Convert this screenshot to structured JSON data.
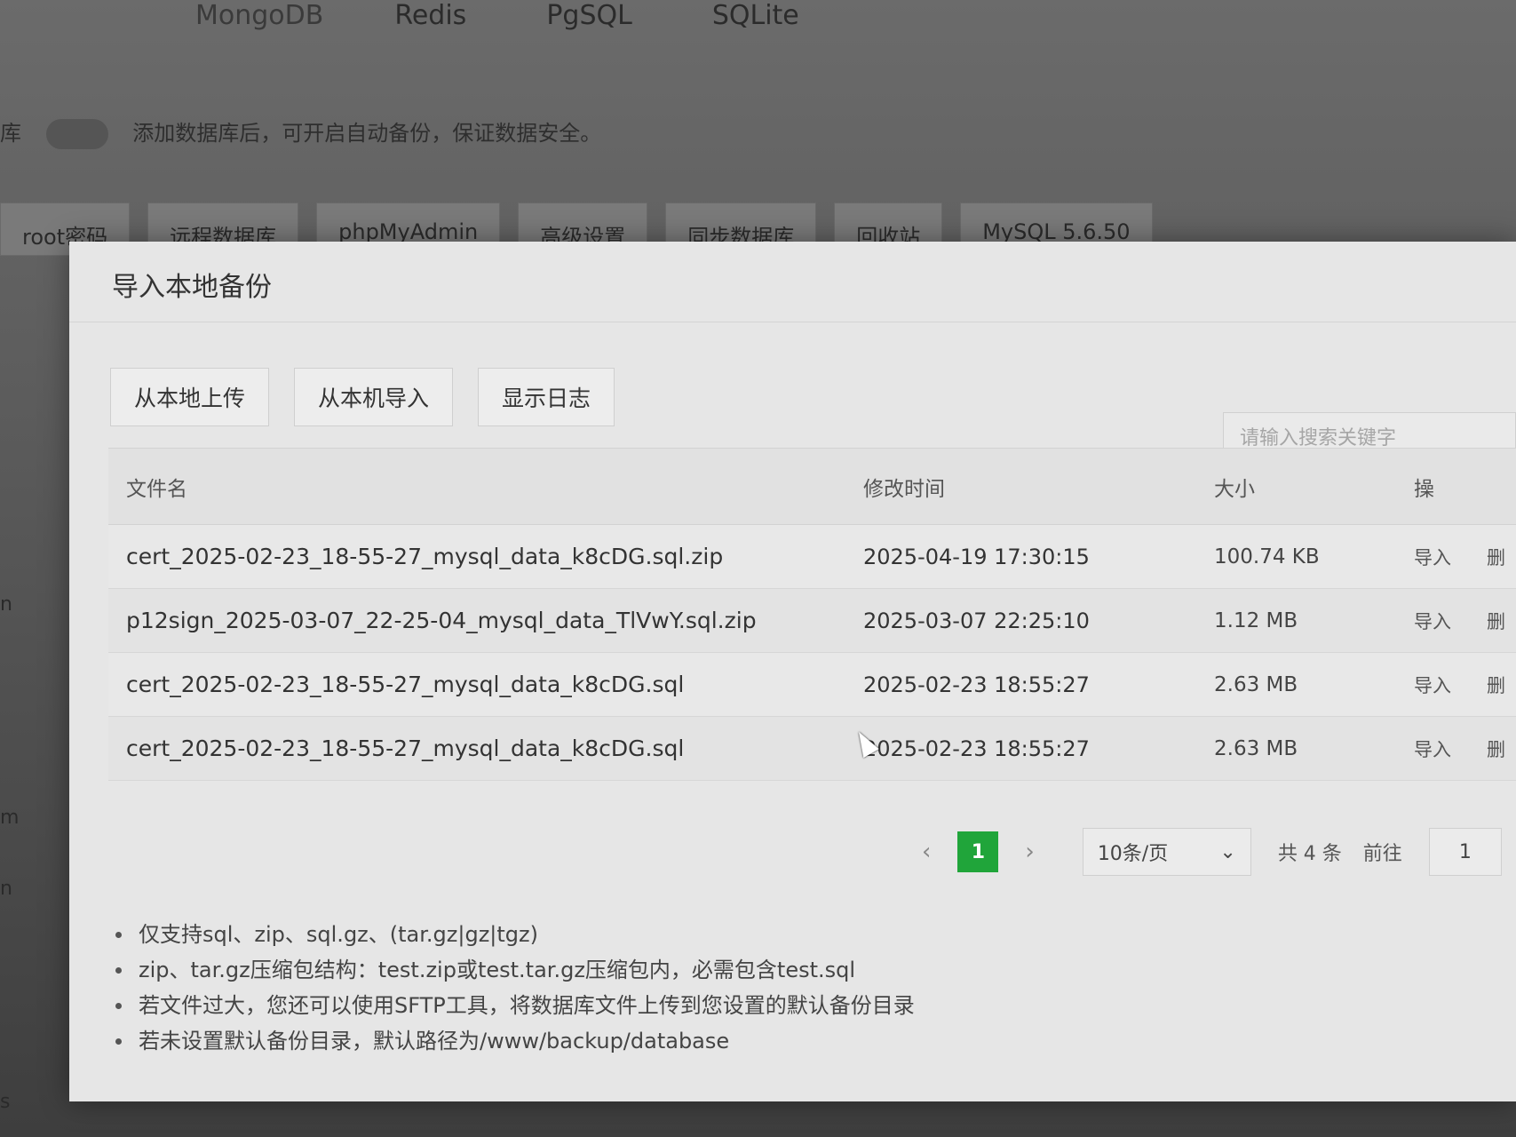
{
  "background": {
    "db_tabs": [
      "MongoDB",
      "Redis",
      "PgSQL",
      "SQLite"
    ],
    "side_label": "库",
    "backup_note": "添加数据库后，可开启自动备份，保证数据安全。",
    "toolbar": [
      "root密码",
      "远程数据库",
      "phpMyAdmin",
      "高级设置",
      "同步数据库",
      "回收站",
      "MySQL 5.6.50"
    ],
    "side_letters": [
      "n",
      "m",
      "n",
      "s"
    ]
  },
  "modal": {
    "title": "导入本地备份",
    "actions": [
      "从本地上传",
      "从本机导入",
      "显示日志"
    ],
    "search_placeholder": "请输入搜索关键字",
    "table": {
      "headers": {
        "name": "文件名",
        "time": "修改时间",
        "size": "大小",
        "op": "操"
      },
      "rows": [
        {
          "name": "cert_2025-02-23_18-55-27_mysql_data_k8cDG.sql.zip",
          "time": "2025-04-19 17:30:15",
          "size": "100.74 KB",
          "import": "导入",
          "del": "删"
        },
        {
          "name": "p12sign_2025-03-07_22-25-04_mysql_data_TlVwY.sql.zip",
          "time": "2025-03-07 22:25:10",
          "size": "1.12 MB",
          "import": "导入",
          "del": "删"
        },
        {
          "name": "cert_2025-02-23_18-55-27_mysql_data_k8cDG.sql",
          "time": "2025-02-23 18:55:27",
          "size": "2.63 MB",
          "import": "导入",
          "del": "删"
        },
        {
          "name": "cert_2025-02-23_18-55-27_mysql_data_k8cDG.sql",
          "time": "2025-02-23 18:55:27",
          "size": "2.63 MB",
          "import": "导入",
          "del": "删"
        }
      ]
    },
    "pager": {
      "prev": "‹",
      "current": "1",
      "next": "›",
      "page_size": "10条/页",
      "total": "共 4 条",
      "goto": "前往",
      "goto_value": "1"
    },
    "tips": [
      "仅支持sql、zip、sql.gz、(tar.gz|gz|tgz)",
      "zip、tar.gz压缩包结构：test.zip或test.tar.gz压缩包内，必需包含test.sql",
      "若文件过大，您还可以使用SFTP工具，将数据库文件上传到您设置的默认备份目录",
      "若未设置默认备份目录，默认路径为/www/backup/database"
    ]
  },
  "colors": {
    "accent": "#20a53a"
  }
}
